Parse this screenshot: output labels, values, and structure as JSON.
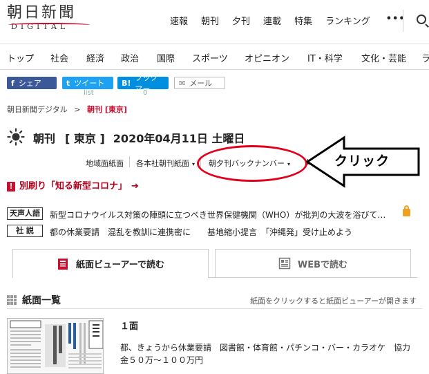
{
  "logo": {
    "main": "朝日新聞",
    "sub": "DIGITAL"
  },
  "topnav": [
    "速報",
    "朝刊",
    "夕刊",
    "連載",
    "特集",
    "ランキング"
  ],
  "topnav_more": "•••",
  "catnav": [
    "トップ",
    "社会",
    "経済",
    "政治",
    "国際",
    "スポーツ",
    "オピニオン",
    "IT・科学",
    "文化・芸能",
    "ラ"
  ],
  "share": {
    "facebook": {
      "icon": "f",
      "label": "シェア"
    },
    "twitter": {
      "icon": "t",
      "label": "ツイート",
      "count": "list"
    },
    "hatena": {
      "icon": "B!",
      "label": "ブックマー",
      "count": "0"
    },
    "mail": {
      "label": "メール"
    }
  },
  "breadcrumb": {
    "home": "朝日新聞デジタル",
    "sep": ">",
    "current": "朝刊 [東京]"
  },
  "heading": {
    "title": "朝刊",
    "edition": "[ 東京 ]",
    "date": "2020年04月11日 土曜日"
  },
  "subnav": {
    "regional": "地域面紙面",
    "branch": "各本社朝刊紙面",
    "backnumber": "朝夕刊バックナンバー",
    "caret": "▾",
    "fragment": "b"
  },
  "annotation": {
    "text": "クリック",
    "color": "#e3001b"
  },
  "alert": {
    "icon": "!",
    "text": "別刷り「知る新型コロナ」",
    "arrow": "➔"
  },
  "columns": [
    {
      "badge": "天声人語",
      "text": "新型コロナウイルス対策の陣頭に立つべき世界保健機関（WHO）が批判の大波を浴びて…"
    },
    {
      "badge": "社 説",
      "text": "都の休業要請　混乱を教訓に連携密に　　基地縮小提言　「沖縄発」受け止めよう"
    }
  ],
  "tabs": {
    "viewer": "紙面ビューアーで読む",
    "web": "WEBで読む"
  },
  "section": {
    "title": "紙面一覧",
    "note": "紙面をクリックすると紙面ビューアーが開きます"
  },
  "page": {
    "number": "１面",
    "description": "都、きょうから休業要請　図書館・体育館・パチンコ・バー・カラオケ　協力金５０万～１００万円",
    "thumb_texts": [
      "天声人語",
      "朝日新聞"
    ]
  },
  "colors": {
    "accent": "#c8102e",
    "link_red": "#b3001b",
    "facebook": "#3b5998",
    "twitter": "#1da1f2",
    "hatena": "#008fde"
  }
}
